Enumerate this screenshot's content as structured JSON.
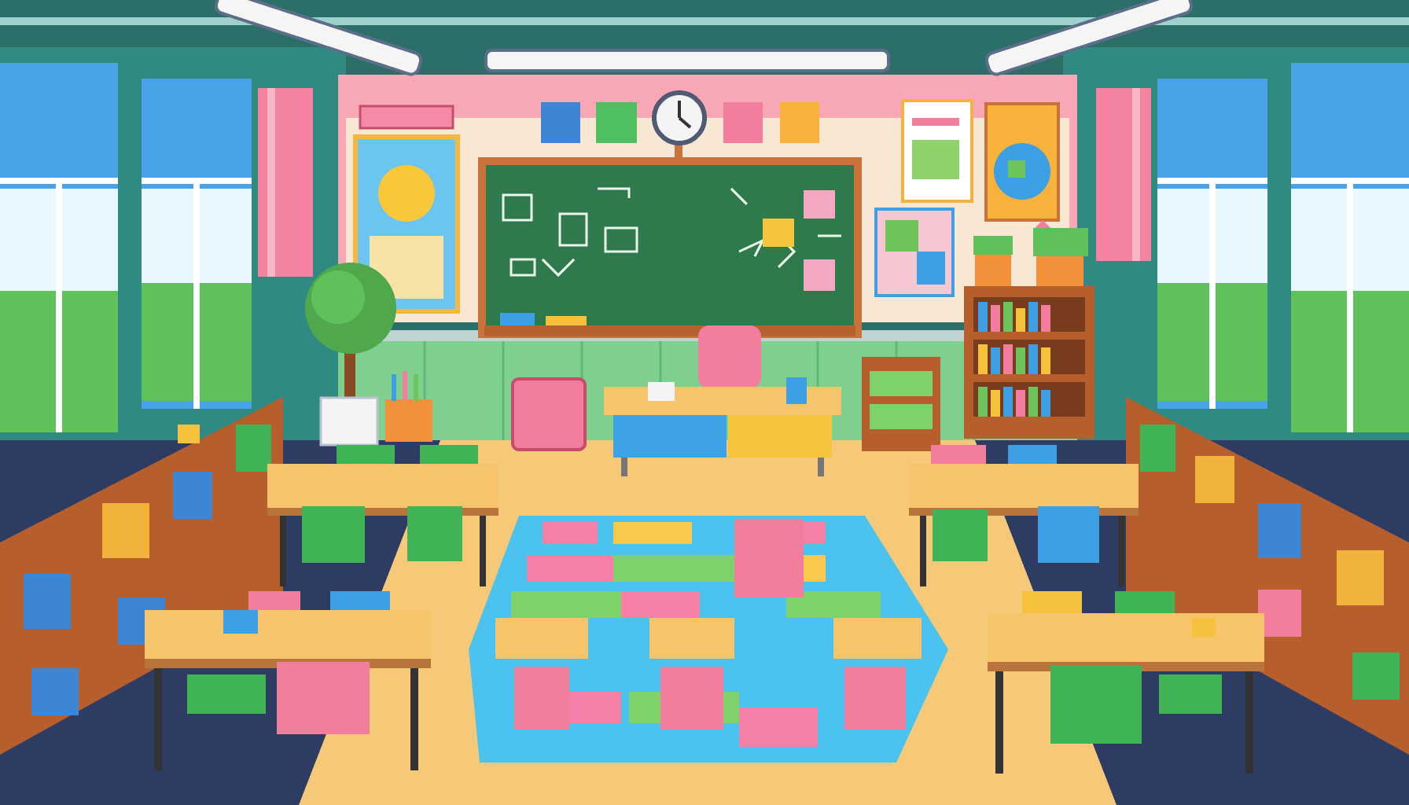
{
  "scene": {
    "type": "pixel-art classroom",
    "colors": {
      "wall_upper": "#f7a8b4",
      "wall_cream": "#f8e7d2",
      "wall_green": "#7fcf8f",
      "side_wall": "#2f8a82",
      "ceiling": "#2c6f68",
      "chalkboard": "#2f7a4d",
      "board_frame": "#c9733a",
      "floor_tile": "#f6c978",
      "floor_dark": "#2e3b63",
      "desk_top": "#f6c46a",
      "desk_edge": "#b8743a",
      "shelf_wood": "#b65e2c",
      "curtain": "#f483a0",
      "sky": "#4aa3e6",
      "foliage": "#5fc15a",
      "rug_blue": "#4cc3ee",
      "rug_pink": "#f57fa6",
      "rug_green": "#7fd26a",
      "rug_yellow": "#f8c94a",
      "chair_green": "#3fb356",
      "chair_pink": "#f27d9c",
      "chair_blue": "#3d9fe4",
      "chair_yellow": "#f6c13c",
      "teacher_desk_blue": "#3ea2e6",
      "teacher_desk_yellow": "#f7c53b",
      "clock_face": "#f4f4f4",
      "sun": "#f9c73a"
    },
    "objects": [
      "ceiling-light",
      "wall-clock",
      "chalkboard",
      "sun-poster",
      "globe-poster",
      "map-poster",
      "chart-poster",
      "teacher-desk",
      "teacher-chair",
      "potted-tree",
      "trash-bin",
      "bookshelf",
      "windows",
      "curtains",
      "student-desks",
      "student-chairs",
      "play-rug",
      "side-cubby-shelves"
    ]
  }
}
